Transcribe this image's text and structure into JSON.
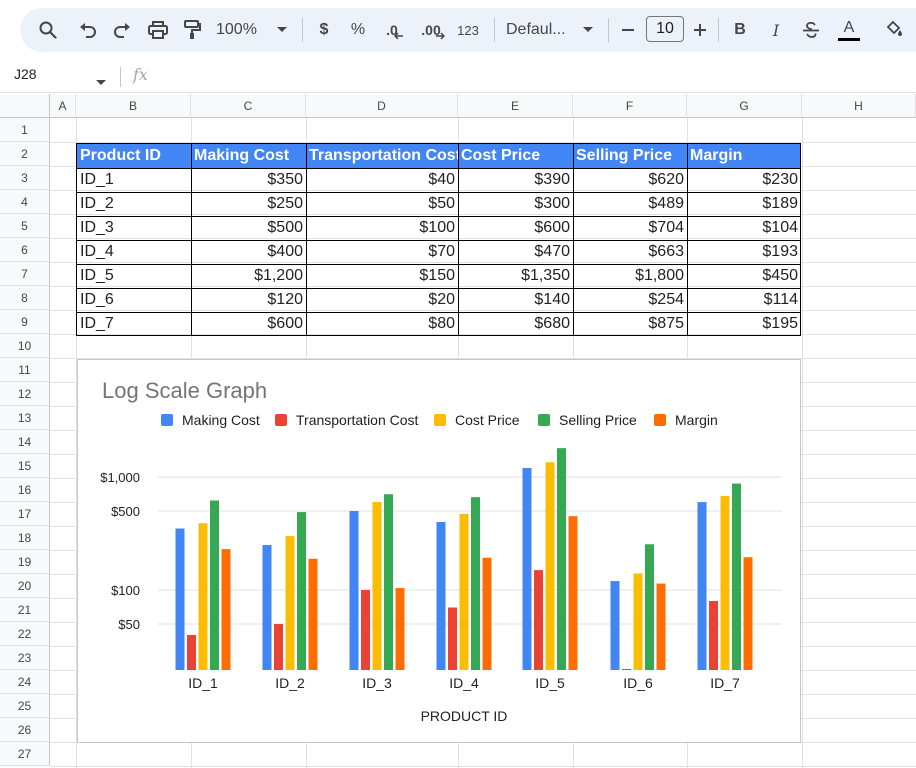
{
  "toolbar": {
    "zoom": "100%",
    "currency": "$",
    "percent": "%",
    "decrease_decimal": ".0",
    "increase_decimal": ".00",
    "number_format": "123",
    "font": "Defaul...",
    "font_size": "10",
    "bold": "B",
    "italic": "I",
    "text_color": "A"
  },
  "formula_bar": {
    "cell_ref": "J28",
    "fx_label": "fx"
  },
  "grid": {
    "columns": [
      "A",
      "B",
      "C",
      "D",
      "E",
      "F",
      "G",
      "H"
    ],
    "rows": [
      "1",
      "2",
      "3",
      "4",
      "5",
      "6",
      "7",
      "8",
      "9",
      "10",
      "11",
      "12",
      "13",
      "14",
      "15",
      "16",
      "17",
      "18",
      "19",
      "20",
      "21",
      "22",
      "23",
      "24",
      "25",
      "26",
      "27"
    ]
  },
  "table": {
    "headers": [
      "Product ID",
      "Making Cost",
      "Transportation Cost",
      "Cost Price",
      "Selling Price",
      "Margin"
    ],
    "rows": [
      [
        "ID_1",
        "$350",
        "$40",
        "$390",
        "$620",
        "$230"
      ],
      [
        "ID_2",
        "$250",
        "$50",
        "$300",
        "$489",
        "$189"
      ],
      [
        "ID_3",
        "$500",
        "$100",
        "$600",
        "$704",
        "$104"
      ],
      [
        "ID_4",
        "$400",
        "$70",
        "$470",
        "$663",
        "$193"
      ],
      [
        "ID_5",
        "$1,200",
        "$150",
        "$1,350",
        "$1,800",
        "$450"
      ],
      [
        "ID_6",
        "$120",
        "$20",
        "$140",
        "$254",
        "$114"
      ],
      [
        "ID_7",
        "$600",
        "$80",
        "$680",
        "$875",
        "$195"
      ]
    ]
  },
  "chart_data": {
    "type": "bar",
    "title": "Log Scale Graph",
    "xlabel": "PRODUCT ID",
    "ylabel": "",
    "scale": "log",
    "yticks": [
      50,
      100,
      500,
      1000
    ],
    "ytick_labels": [
      "$50",
      "$100",
      "$500",
      "$1,000"
    ],
    "grid": true,
    "legend_position": "top",
    "categories": [
      "ID_1",
      "ID_2",
      "ID_3",
      "ID_4",
      "ID_5",
      "ID_6",
      "ID_7"
    ],
    "series": [
      {
        "name": "Making Cost",
        "color": "#4285f4",
        "values": [
          350,
          250,
          500,
          400,
          1200,
          120,
          600
        ]
      },
      {
        "name": "Transportation Cost",
        "color": "#ea4335",
        "values": [
          40,
          50,
          100,
          70,
          150,
          20,
          80
        ]
      },
      {
        "name": "Cost Price",
        "color": "#fbbc04",
        "values": [
          390,
          300,
          600,
          470,
          1350,
          140,
          680
        ]
      },
      {
        "name": "Selling Price",
        "color": "#34a853",
        "values": [
          620,
          489,
          704,
          663,
          1800,
          254,
          875
        ]
      },
      {
        "name": "Margin",
        "color": "#ff6d01",
        "values": [
          230,
          189,
          104,
          193,
          450,
          114,
          195
        ]
      }
    ]
  }
}
